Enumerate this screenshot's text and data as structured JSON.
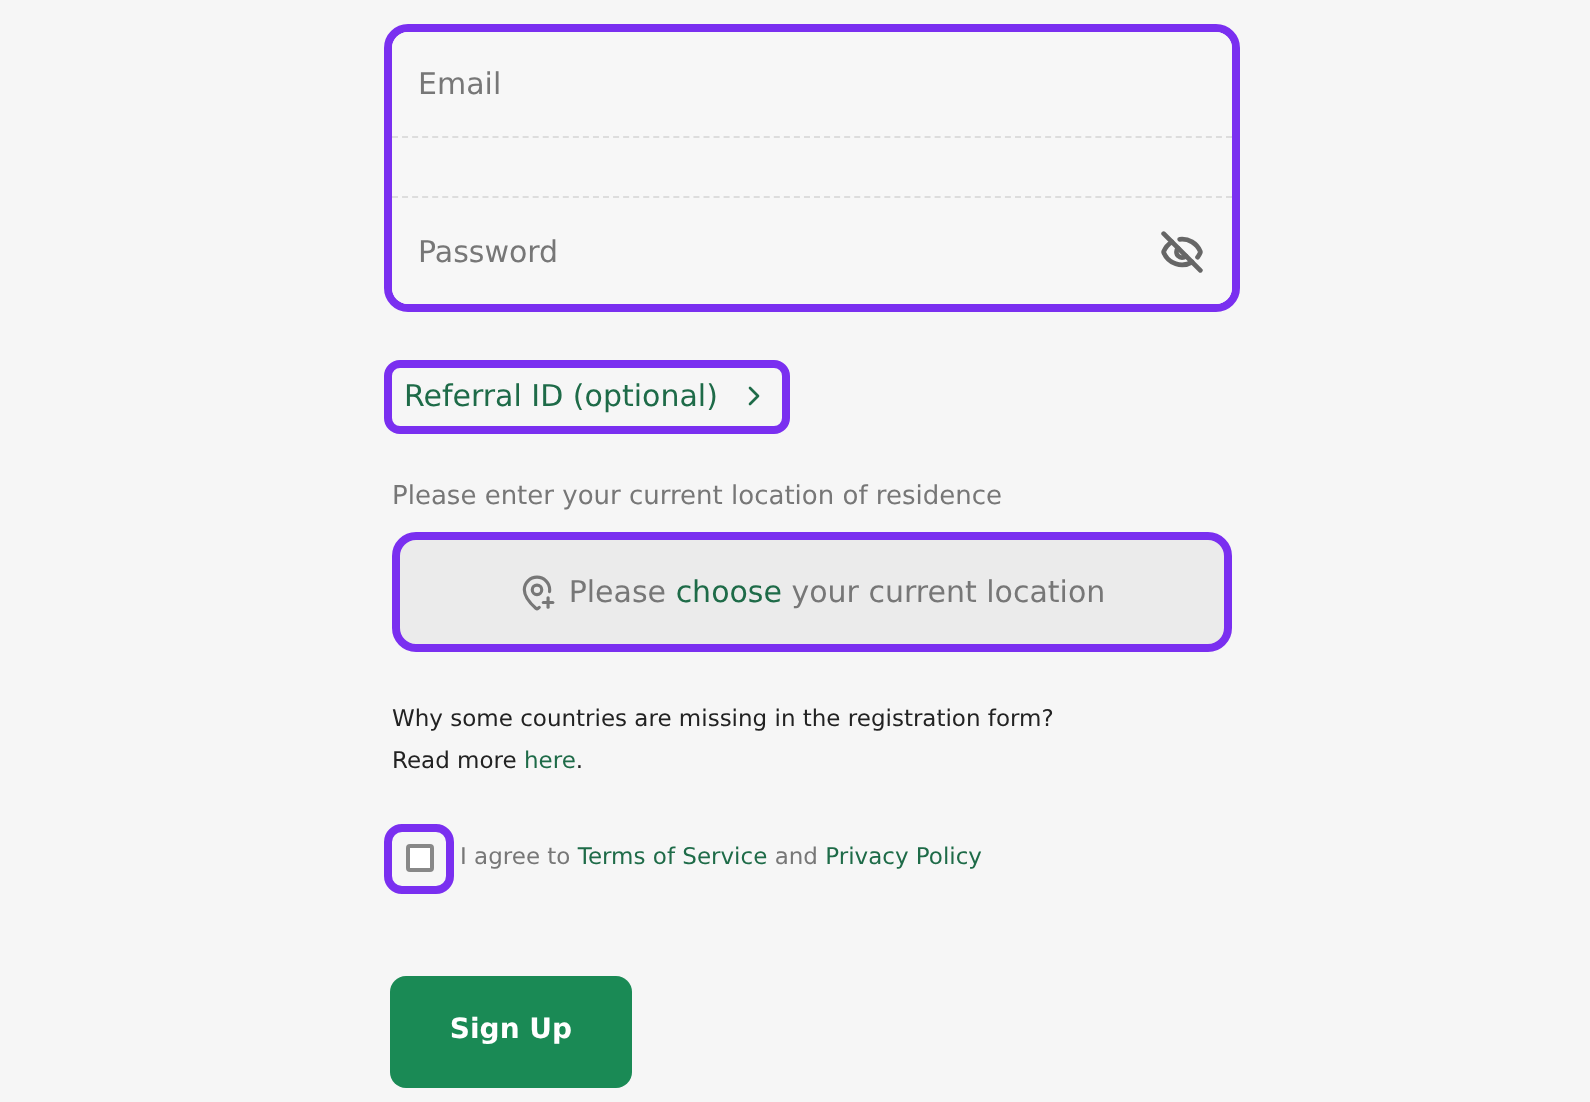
{
  "credentials": {
    "email": {
      "placeholder": "Email"
    },
    "password": {
      "placeholder": "Password",
      "visible": false
    }
  },
  "referral": {
    "label": "Referral ID (optional)",
    "expanded": false
  },
  "location": {
    "label": "Please enter your current location of residence",
    "button": {
      "prefix": "Please",
      "link": "choose",
      "suffix": "your current location"
    }
  },
  "note": {
    "question": "Why some countries are missing in the registration form?",
    "prefix": "Read more",
    "link": "here",
    "suffix": "."
  },
  "agreement": {
    "checked": false,
    "prefix": "I agree to",
    "terms": "Terms of Service",
    "joiner": "and",
    "privacy": "Privacy Policy"
  },
  "submit": {
    "label": "Sign Up"
  }
}
